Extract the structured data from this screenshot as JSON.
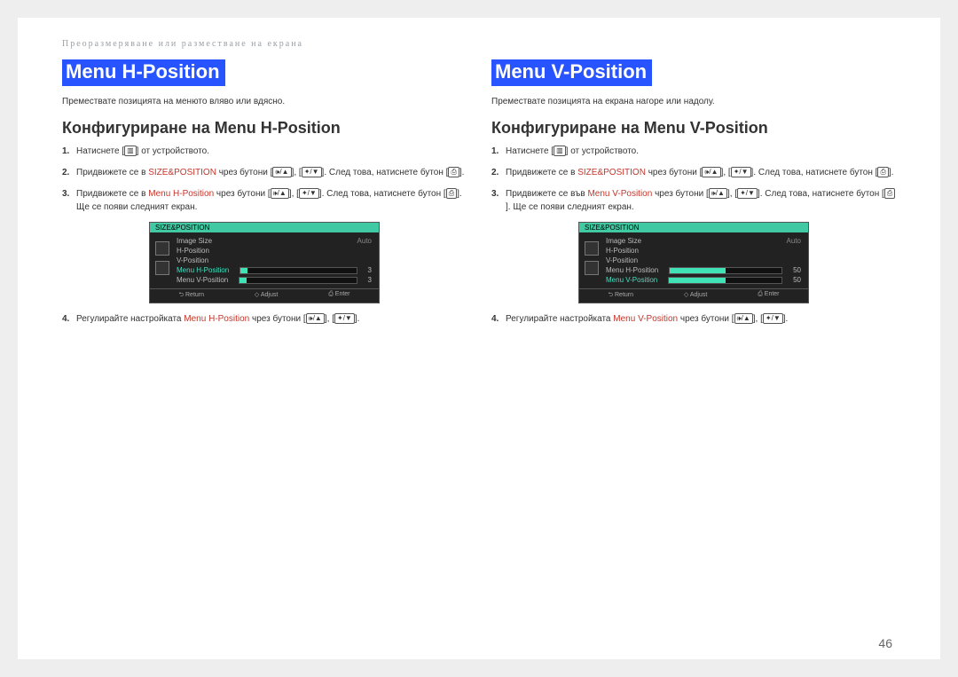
{
  "breadcrumb": "Преоразмеряване или разместване на екрана",
  "pagenum": "46",
  "icons": {
    "menu": "▥",
    "vol_up": "🕪/▲",
    "vol_dn": "✦/▼",
    "enter": "⎙"
  },
  "osd": {
    "header": "SIZE&POSITION",
    "items": [
      "Image Size",
      "H-Position",
      "V-Position",
      "Menu H-Position",
      "Menu V-Position"
    ],
    "valAuto": "Auto",
    "num": "3",
    "footer": [
      "⮌ Return",
      "◇ Adjust",
      "⎙ Enter"
    ]
  },
  "left": {
    "title": "Menu H-Position",
    "desc": "Премествате позицията на менюто вляво или вдясно.",
    "sub": "Конфигуриране на Menu H-Position",
    "hl": "Menu H-Position",
    "hlList": "Menu H-Position",
    "s1": "Натиснете ",
    "s1b": " от устройството.",
    "s2a": "Придвижете се в ",
    "s2b": " чрез бутони ",
    "s2c": ". След това, натиснете бутон ",
    "s3a": "Придвижете се в ",
    "s3b": " чрез бутони ",
    "s3c": ". След това, натиснете бутон ",
    "s3d": ". Ще се появи следният екран.",
    "s4a": "Регулирайте настройката ",
    "s4b": " чрез бутони ",
    "kwSize": "SIZE&POSITION"
  },
  "right": {
    "title": "Menu V-Position",
    "desc": "Премествате позицията на екрана нагоре или надолу.",
    "sub": "Конфигуриране на Menu V-Position",
    "hl": "Menu V-Position",
    "hlList": "Menu V-Position",
    "s1": "Натиснете ",
    "s1b": " от устройството.",
    "s2a": "Придвижете се в ",
    "s2b": " чрез бутони ",
    "s2c": ". След това, натиснете бутон ",
    "s3a": "Придвижете се във ",
    "s3b": " чрез бутони ",
    "s3c": ". След това, натиснете бутон ",
    "s3d": ".  Ще се появи следният екран.",
    "s4a": "Регулирайте настройката ",
    "s4b": " чрез бутони ",
    "osdNum": "50",
    "kwSize": "SIZE&POSITION"
  }
}
